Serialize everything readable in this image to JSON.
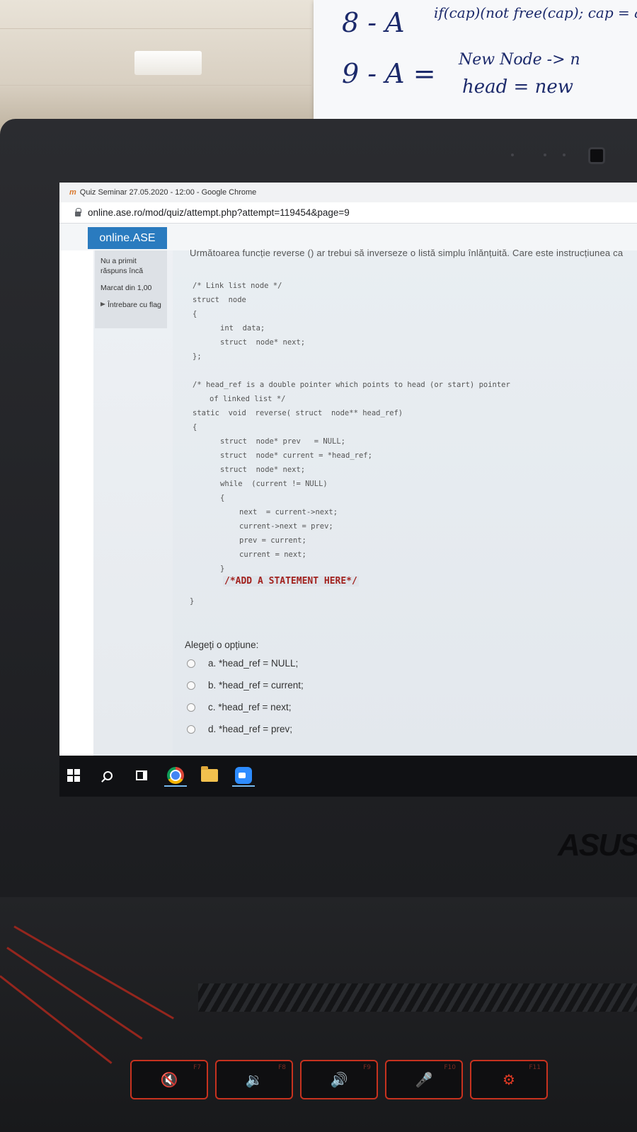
{
  "note": {
    "line1": "8 - A",
    "line1_script": "if(cap)(not free(cap); cap = a",
    "line2": "9 - A =",
    "line2_script": "New Node -> n",
    "line3_script": "head = new"
  },
  "browser": {
    "window_title": "Quiz Seminar 27.05.2020 - 12:00 - Google Chrome",
    "url": "online.ase.ro/mod/quiz/attempt.php?attempt=119454&page=9"
  },
  "site": {
    "logo": "online.ASE"
  },
  "question_info": {
    "status": "Nu a primit răspuns încă",
    "mark": "Marcat din 1,00",
    "flag": "Întrebare cu flag"
  },
  "question": {
    "intro": "Următoarea funcție reverse () ar trebui să inverseze o listă simplu înlănțuită. Care este instrucțiunea ca",
    "code": [
      "/* Link list node */",
      "struct  node",
      "{",
      "int  data;",
      "struct  node* next;",
      "};",
      "/* head_ref is a double pointer which points to head (or start) pointer",
      "of linked list */",
      "static  void  reverse( struct  node** head_ref)",
      "{",
      "struct  node* prev   = NULL;",
      "struct  node* current = *head_ref;",
      "struct  node* next;",
      "while  (current != NULL)",
      "{",
      "next  = current->next;",
      "current->next = prev;",
      "prev = current;",
      "current = next;",
      "}",
      "/*ADD A STATEMENT HERE*/",
      "}"
    ],
    "prompt": "Alegeți o opțiune:",
    "options": [
      "a. *head_ref = NULL;",
      "b. *head_ref = current;",
      "c. *head_ref = next;",
      "d. *head_ref = prev;"
    ]
  },
  "taskbar": {
    "icons": [
      "windows-start-icon",
      "search-icon",
      "task-view-icon",
      "chrome-icon",
      "file-explorer-icon",
      "zoom-icon"
    ]
  },
  "device": {
    "brand": "ASUS",
    "keys": [
      "F7",
      "F8",
      "F9",
      "F10",
      "F11"
    ]
  },
  "colors": {
    "logo_bg": "#2a7bbf",
    "code_highlight": "#a2231f",
    "keyboard_accent": "#c7321f"
  }
}
